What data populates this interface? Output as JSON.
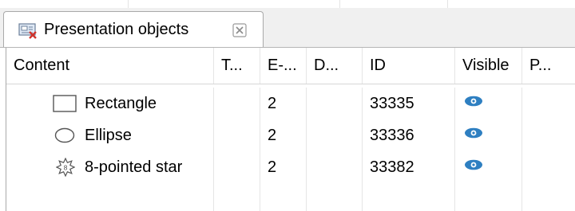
{
  "tab": {
    "title": "Presentation objects",
    "icon": "presentation-objects-icon",
    "close_icon": "close-icon"
  },
  "columns": [
    "Content",
    "T...",
    "E-...",
    "D...",
    "ID",
    "Visible",
    "P..."
  ],
  "rows": [
    {
      "icon": "rectangle-icon",
      "content": "Rectangle",
      "t": "",
      "e": "2",
      "d": "",
      "id": "33335",
      "visible_icon": "eye-icon",
      "p": ""
    },
    {
      "icon": "ellipse-icon",
      "content": "Ellipse",
      "t": "",
      "e": "2",
      "d": "",
      "id": "33336",
      "visible_icon": "eye-icon",
      "p": ""
    },
    {
      "icon": "star-icon",
      "content": "8-pointed star",
      "t": "",
      "e": "2",
      "d": "",
      "id": "33382",
      "visible_icon": "eye-icon",
      "p": ""
    }
  ],
  "colors": {
    "eye": "#2e7fc1",
    "border": "#a9a9a9",
    "gridline": "#e5e5e5",
    "tabbar_bg": "#f0f0f0"
  }
}
